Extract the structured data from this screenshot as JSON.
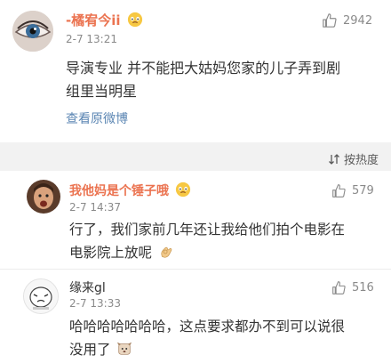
{
  "post": {
    "author": "-橘宥今ii",
    "time": "2-7 13:21",
    "likes": "2942",
    "text_line1": "导演专业 并不能把大姑妈您家的儿子弄到剧",
    "text_line2": "组里当明星",
    "view_original": "查看原微博"
  },
  "sort": {
    "label": "按热度"
  },
  "comments": [
    {
      "author": "我他妈是个锤子哦",
      "time": "2-7 14:37",
      "likes": "579",
      "text_line1": "行了，我们家前几年还让我给他们拍个电影在",
      "text_line2": "电影院上放呢"
    },
    {
      "author": "缘来gl",
      "time": "2-7 13:33",
      "likes": "516",
      "text_line1": "哈哈哈哈哈哈哈，这点要求都办不到可以说很",
      "text_line2": "没用了"
    }
  ],
  "colors": {
    "accent_name": "#eb7350",
    "link": "#5b86b3",
    "meta": "#8a8a8a"
  }
}
